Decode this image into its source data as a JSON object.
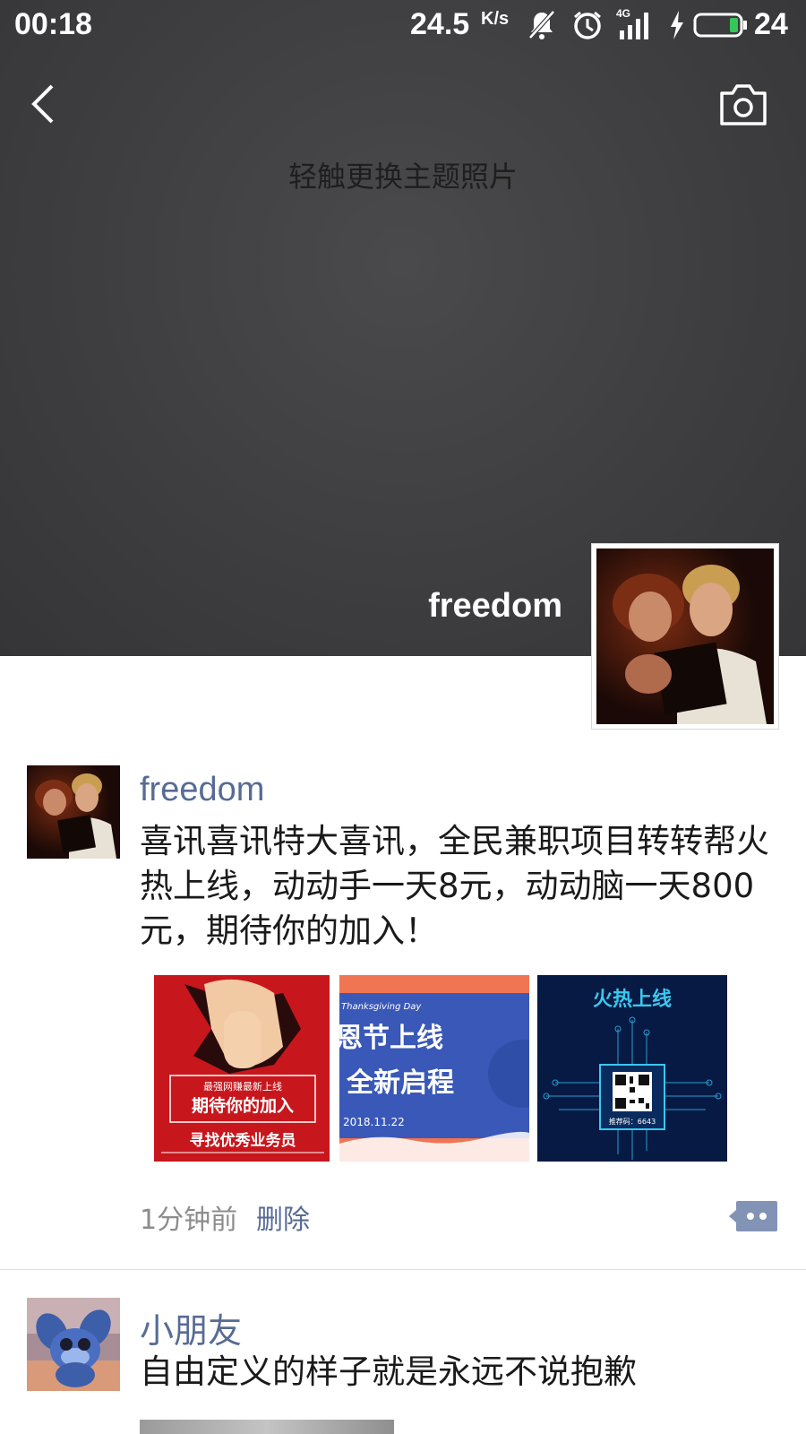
{
  "status_bar": {
    "time": "00:18",
    "network_speed": "24.5",
    "network_speed_unit": "K/s",
    "signal_label": "4G",
    "battery_level": "24",
    "icons": [
      "mute-icon",
      "alarm-icon",
      "signal-icon",
      "charging-icon",
      "battery-icon"
    ]
  },
  "header": {
    "back_icon": "back-arrow-icon",
    "camera_icon": "camera-icon",
    "cover_hint": "轻触更换主题照片",
    "profile_name": "freedom"
  },
  "posts": [
    {
      "author": "freedom",
      "text": "喜讯喜讯特大喜讯，全民兼职项目转转帮火热上线，动动手一天8元，动动脑一天800元，期待你的加入！",
      "images": [
        {
          "texts": [
            "最强网赚最新上线",
            "期待你的加入",
            "寻找优秀业务员"
          ]
        },
        {
          "texts": [
            "Thanksgiving Day",
            "恩节上线",
            "全新启程",
            "2018.11.22"
          ]
        },
        {
          "texts": [
            "火热上线",
            "推荐码：6643"
          ]
        }
      ],
      "time": "1分钟前",
      "delete_label": "删除"
    },
    {
      "author": "小朋友",
      "text": "自由定义的样子就是永远不说抱歉"
    }
  ],
  "colors": {
    "link_blue": "#576b95",
    "cover_bg": "#3f3f41",
    "time_gray": "#8c8c8c"
  }
}
